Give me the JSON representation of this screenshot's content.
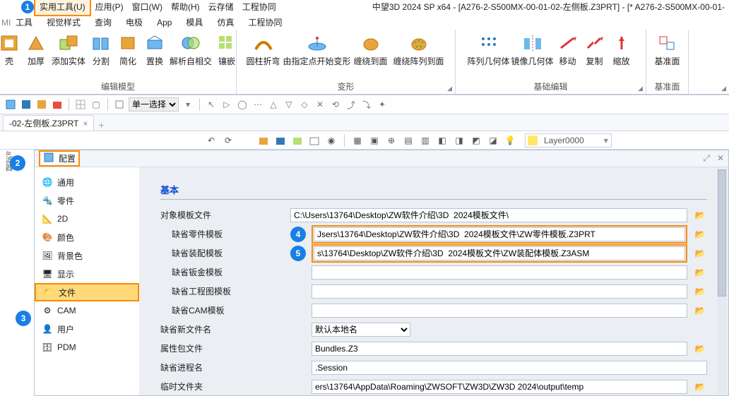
{
  "app_title": "中望3D 2024 SP x64 - [A276-2-S500MX-00-01-02-左侧板.Z3PRT]  - [* A276-2-S500MX-00-01-",
  "menu_top": [
    "实用工具(U)",
    "应用(P)",
    "窗口(W)",
    "帮助(H)",
    "云存储",
    "工程协同"
  ],
  "menu2_left": "工",
  "menu2": [
    "MI",
    "工具",
    "视觉样式",
    "查询",
    "电极",
    "App",
    "模具",
    "仿真",
    "工程协同"
  ],
  "ribbon": {
    "g1": [
      "壳",
      "加厚",
      "添加实体",
      "分割",
      "简化",
      "置换",
      "解析自相交",
      "镶嵌"
    ],
    "g1_label": "编辑模型",
    "g2": [
      "圆柱折弯",
      "由指定点开始变形",
      "缠绕到面",
      "缠绕阵列到面"
    ],
    "g2_label": "变形",
    "g3": [
      "阵列几何体",
      "镜像几何体",
      "移动",
      "复制",
      "缩放"
    ],
    "g3_label": "基础编辑",
    "g4": [
      "基准面"
    ],
    "g4_label": "基准面"
  },
  "select_mode": "单一选择",
  "doc_tab": "-02-左侧板.Z3PRT",
  "layer": "Layer0000",
  "gutter_label": "a滤器",
  "config": {
    "title": "配置",
    "side": [
      "通用",
      "零件",
      "2D",
      "颜色",
      "背景色",
      "显示",
      "文件",
      "CAM",
      "用户",
      "PDM"
    ],
    "section_basic": "基本",
    "rows": {
      "r1": "对象模板文件",
      "r2": "缺省零件模板",
      "r3": "缺省装配模板",
      "r4": "缺省钣金模板",
      "r5": "缺省工程图模板",
      "r6": "缺省CAM模板",
      "r7": "缺省新文件名",
      "r8": "属性包文件",
      "r9": "缺省进程名",
      "r10": "临时文件夹"
    },
    "vals": {
      "v1": "C:\\Users\\13764\\Desktop\\ZW软件介绍\\3D  2024模板文件\\",
      "v2": "Jsers\\13764\\Desktop\\ZW软件介绍\\3D  2024模板文件\\ZW零件模板.Z3PRT",
      "v3": "s\\13764\\Desktop\\ZW软件介绍\\3D  2024模板文件\\ZW装配体模板.Z3ASM",
      "v4": "",
      "v5": "",
      "v6": "",
      "v8": "Bundles.Z3",
      "v9": ".Session",
      "v10": "ers\\13764\\AppData\\Roaming\\ZWSOFT\\ZW3D\\ZW3D 2024\\output\\temp"
    },
    "newname_opt": "默认本地名"
  }
}
